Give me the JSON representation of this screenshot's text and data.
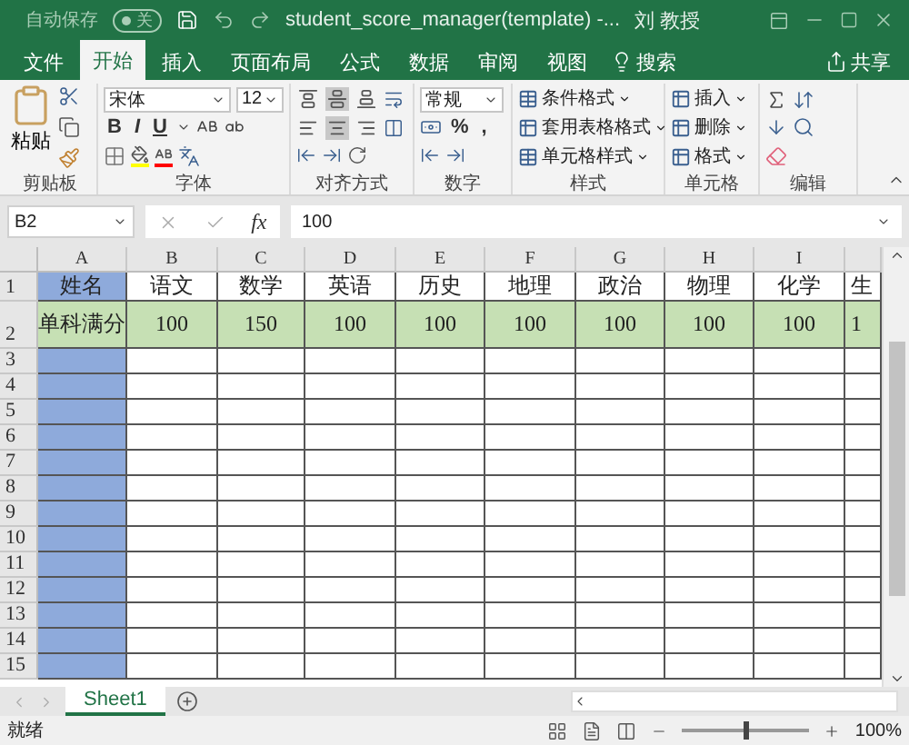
{
  "title_bar": {
    "autosave_label": "自动保存",
    "autosave_state": "关",
    "title": "student_score_manager(template)  -...",
    "user": "刘 教授"
  },
  "tabs": [
    {
      "label": "文件",
      "selected": false
    },
    {
      "label": "开始",
      "selected": true
    },
    {
      "label": "插入",
      "selected": false
    },
    {
      "label": "页面布局",
      "selected": false
    },
    {
      "label": "公式",
      "selected": false
    },
    {
      "label": "数据",
      "selected": false
    },
    {
      "label": "审阅",
      "selected": false
    },
    {
      "label": "视图",
      "selected": false
    }
  ],
  "search": "搜索",
  "share": "共享",
  "ribbon": {
    "clipboard": {
      "paste": "粘贴",
      "label": "剪贴板"
    },
    "font": {
      "name": "宋体",
      "size": "12",
      "bold": "B",
      "italic": "I",
      "underline": "U",
      "label": "字体"
    },
    "alignment": {
      "vertical": [
        {
          "selected": false
        },
        {
          "selected": true
        },
        {
          "selected": false
        }
      ],
      "horizontal": [
        {
          "selected": false
        },
        {
          "selected": true
        },
        {
          "selected": false
        }
      ],
      "label": "对齐方式"
    },
    "number": {
      "format": "常规",
      "percent": "%",
      "comma": ",",
      "label": "数字"
    },
    "styles": {
      "items": [
        "条件格式",
        "套用表格格式",
        "单元格样式"
      ],
      "label": "样式"
    },
    "cells": {
      "items": [
        "插入",
        "删除",
        "格式"
      ],
      "label": "单元格"
    },
    "editing": {
      "label": "编辑"
    }
  },
  "formula_bar": {
    "name_box": "B2",
    "function_label": "fx",
    "value": "100"
  },
  "columns": [
    "A",
    "B",
    "C",
    "D",
    "E",
    "F",
    "G",
    "H",
    "I"
  ],
  "rows": [
    {
      "number": "1",
      "kind": "heading",
      "cells": [
        "姓名",
        "语文",
        "数学",
        "英语",
        "历史",
        "地理",
        "政治",
        "物理",
        "化学",
        "生"
      ]
    },
    {
      "number": "2",
      "kind": "full_marks",
      "cells": [
        "单科满分",
        "100",
        "150",
        "100",
        "100",
        "100",
        "100",
        "100",
        "100",
        "1"
      ]
    },
    {
      "number": "3",
      "kind": "blank"
    },
    {
      "number": "4",
      "kind": "blank"
    },
    {
      "number": "5",
      "kind": "blank"
    },
    {
      "number": "6",
      "kind": "blank"
    },
    {
      "number": "7",
      "kind": "blank"
    },
    {
      "number": "8",
      "kind": "blank"
    },
    {
      "number": "9",
      "kind": "blank"
    },
    {
      "number": "10",
      "kind": "blank"
    },
    {
      "number": "11",
      "kind": "blank"
    },
    {
      "number": "12",
      "kind": "blank"
    },
    {
      "number": "13",
      "kind": "blank"
    },
    {
      "number": "14",
      "kind": "blank"
    },
    {
      "number": "15",
      "kind": "blank"
    }
  ],
  "sheet_tabs": [
    {
      "label": "Sheet1",
      "selected": true
    }
  ],
  "status_bar": {
    "status": "就绪",
    "zoom": {
      "reading": "100%",
      "level": 0.5
    }
  }
}
